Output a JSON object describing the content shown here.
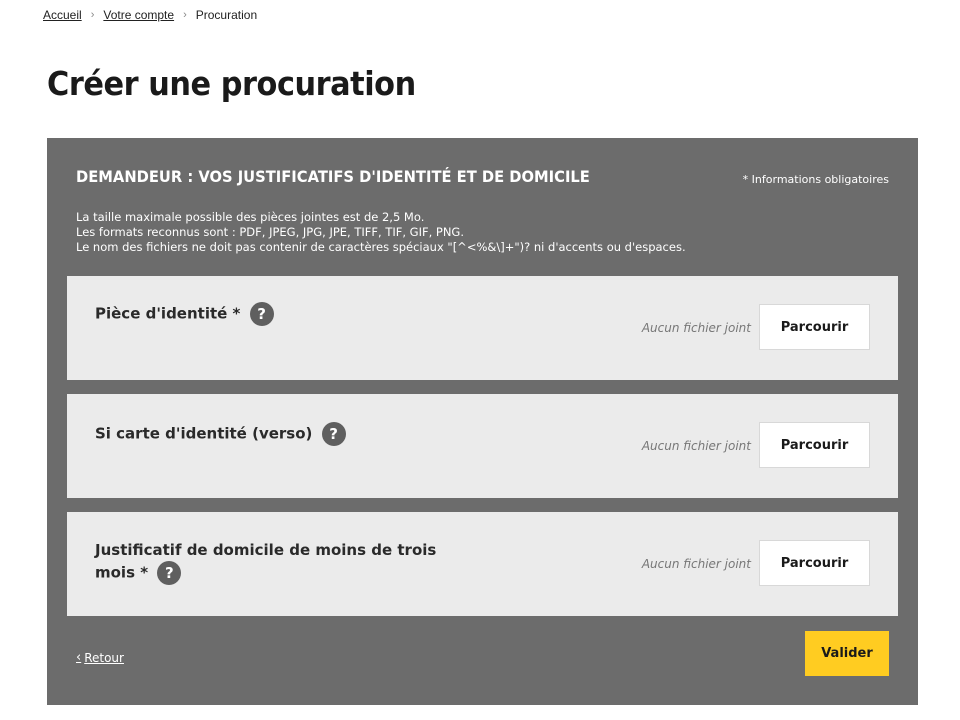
{
  "breadcrumb": {
    "items": [
      {
        "label": "Accueil"
      },
      {
        "label": "Votre compte"
      }
    ],
    "current": "Procuration"
  },
  "page": {
    "title": "Créer une procuration"
  },
  "panel": {
    "title": "DEMANDEUR : VOS JUSTIFICATIFS D'IDENTITÉ ET DE DOMICILE",
    "required_note": "* Informations obligatoires",
    "info_lines": [
      "La taille maximale possible des pièces jointes est de 2,5 Mo.",
      "Les formats reconnus sont : PDF, JPEG, JPG, JPE, TIFF, TIF, GIF, PNG.",
      "Le nom des fichiers ne doit pas contenir de caractères spéciaux \"[^<%&\\]+\")? ni d'accents ou d'espaces."
    ],
    "uploads": [
      {
        "label": "Pièce d'identité *",
        "help": "?",
        "status": "Aucun fichier joint",
        "button": "Parcourir"
      },
      {
        "label": "Si carte d'identité (verso)",
        "help": "?",
        "status": "Aucun fichier joint",
        "button": "Parcourir"
      },
      {
        "label": "Justificatif de domicile de moins de trois mois *",
        "help": "?",
        "status": "Aucun fichier joint",
        "button": "Parcourir"
      }
    ],
    "back_label": "Retour",
    "back_icon": "chevron-left-icon",
    "submit_label": "Valider"
  },
  "colors": {
    "panel_bg": "#6c6c6c",
    "card_bg": "#ebebeb",
    "submit_bg": "#ffcc21",
    "help_icon_bg": "#5f5f5f"
  }
}
